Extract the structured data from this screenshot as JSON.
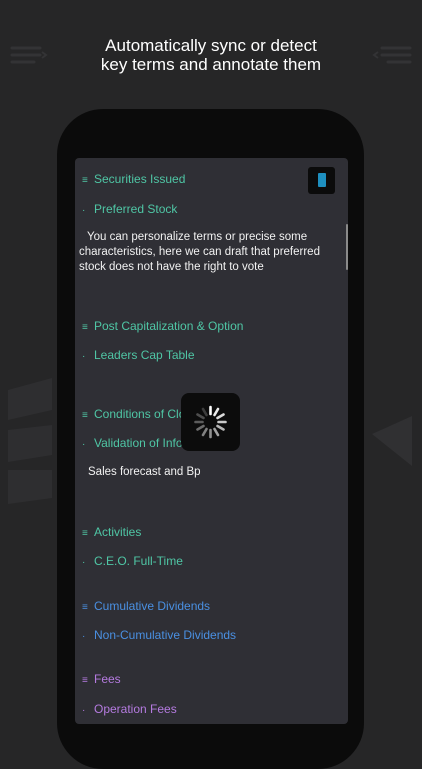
{
  "headline": {
    "line1": "Automatically sync or detect",
    "line2": "key terms and annotate them"
  },
  "document": {
    "sections": [
      {
        "title": "Securities Issued",
        "item": "Preferred Stock",
        "color": "#4fc6a5"
      },
      {
        "title": "Post Capitalization & Option",
        "item": "Leaders Cap Table",
        "color": "#4fc6a5"
      },
      {
        "title": "Conditions of Clo",
        "item": "Validation of Info",
        "color": "#4fc6a5"
      },
      {
        "title": "Activities",
        "item": "C.E.O. Full-Time",
        "color": "#4fc6a5"
      },
      {
        "title": "Cumulative Dividends",
        "item": "Non-Cumulative Dividends",
        "color": "#4a90e2"
      },
      {
        "title": "Fees",
        "item": "Operation Fees",
        "color": "#b57be0"
      }
    ],
    "note1": "You can personalize terms or precise some characteristics, here we can draft that preferred stock does not have the right to vote",
    "note2": "Sales forecast and Bp",
    "section_icon": "list-lines-icon",
    "item_bullet": "·"
  },
  "overlay": {
    "spinner_icon": "loading-spinner-icon"
  }
}
